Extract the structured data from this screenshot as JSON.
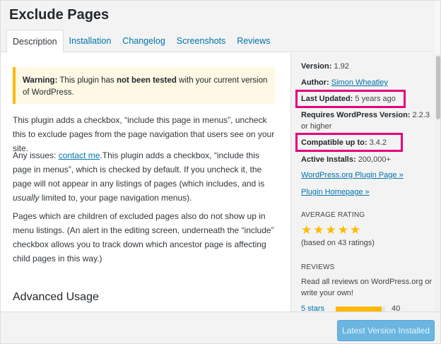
{
  "header": {
    "title": "Exclude Pages",
    "tabs": [
      {
        "label": "Description",
        "active": true
      },
      {
        "label": "Installation"
      },
      {
        "label": "Changelog"
      },
      {
        "label": "Screenshots"
      },
      {
        "label": "Reviews"
      }
    ]
  },
  "main": {
    "warning": {
      "prefix": "Warning:",
      "middle": " This plugin has ",
      "bold": "not been tested",
      "suffix": " with your current version of WordPress."
    },
    "para1": "This plugin adds a checkbox, “include this page in menus”, uncheck this to exclude pages from the page navigation that users see on your site.",
    "para2": {
      "before": "Any issues: ",
      "link": "contact me",
      "after_link": ".This plugin adds a checkbox, “include this page in menus”, which is checked by default. If you uncheck it, the page will not appear in any listings of pages (which includes, and is ",
      "italic": "usually",
      "end": " limited to, your page navigation menus)."
    },
    "para3": "Pages which are children of excluded pages also do not show up in menu listings. (An alert in the editing screen, underneath the “include” checkbox allows you to track down which ancestor page is affecting child pages in this way.)",
    "advanced_heading": "Advanced Usage"
  },
  "sidebar": {
    "version_label": "Version:",
    "version_value": "1.92",
    "author_label": "Author:",
    "author_value": "Simon Wheatley",
    "last_updated_label": "Last Updated:",
    "last_updated_value": "5 years ago",
    "requires_label": "Requires WordPress Version:",
    "requires_value": "2.2.3 or higher",
    "compatible_label": "Compatible up to:",
    "compatible_value": "3.4.2",
    "installs_label": "Active Installs:",
    "installs_value": "200,000+",
    "plugin_page_link": "WordPress.org Plugin Page »",
    "homepage_link": "Plugin Homepage »",
    "average_rating_heading": "AVERAGE RATING",
    "rating_count_text": "(based on 43 ratings)",
    "rating_stars": 5,
    "reviews_heading": "REVIEWS",
    "reviews_text": "Read all reviews on WordPress.org or write your own!",
    "rating_row": {
      "label": "5 stars",
      "count": "40",
      "fraction": 0.93
    }
  },
  "footer": {
    "install_button": "Latest Version Installed"
  },
  "colors": {
    "highlight": "#e5007e",
    "accent": "#0073aa",
    "star": "#ffb900",
    "button": "#6ab6e1"
  }
}
